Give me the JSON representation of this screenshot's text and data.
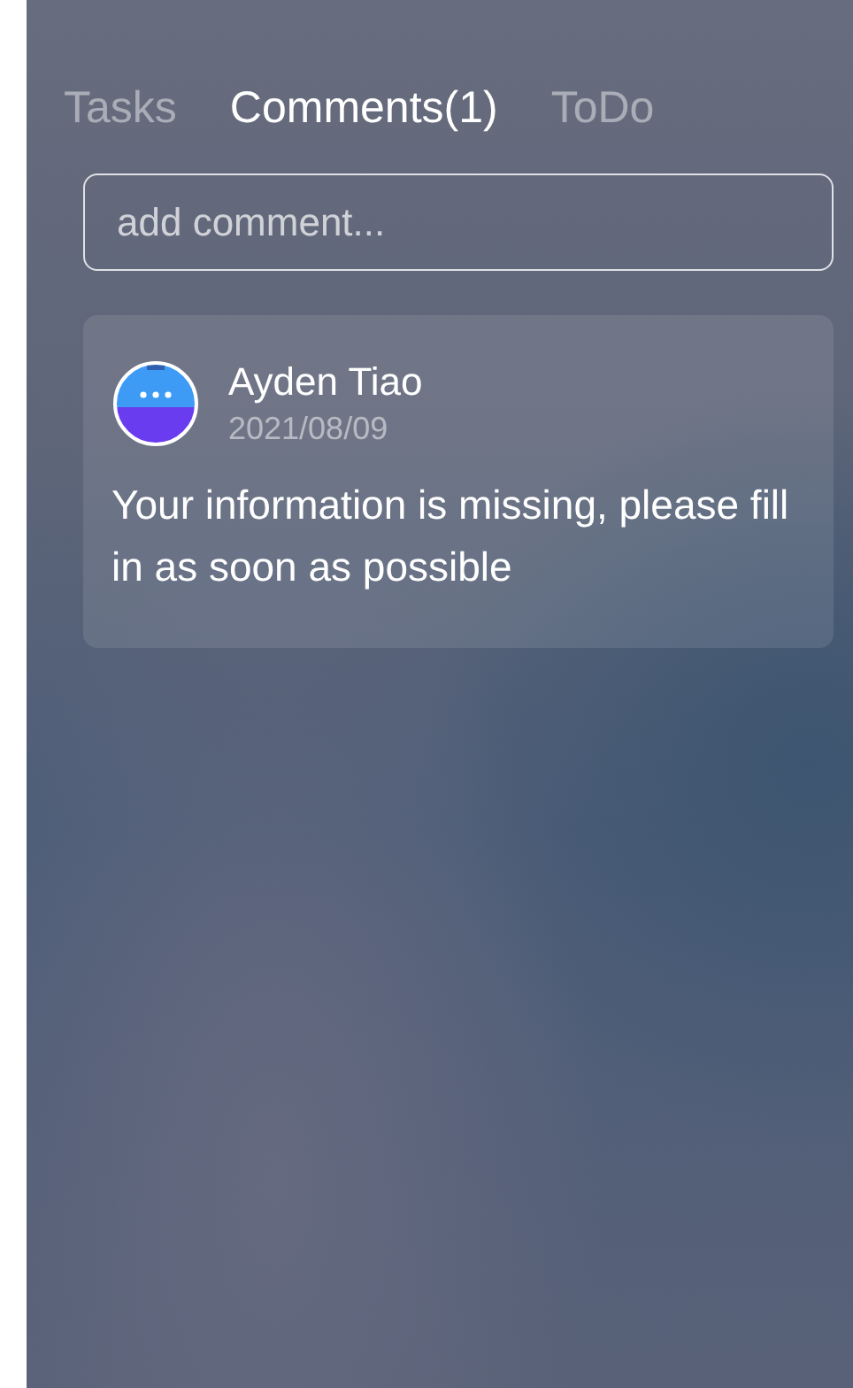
{
  "tabs": [
    {
      "label": "Tasks",
      "selected": false
    },
    {
      "label": "Comments(1)",
      "selected": true
    },
    {
      "label": "ToDo",
      "selected": false
    }
  ],
  "comment_field": {
    "placeholder": "add comment..."
  },
  "comments": [
    {
      "author": "Ayden Tiao",
      "date": "2021/08/09",
      "text": "Your information is missing, please fill in as soon as possible"
    }
  ]
}
